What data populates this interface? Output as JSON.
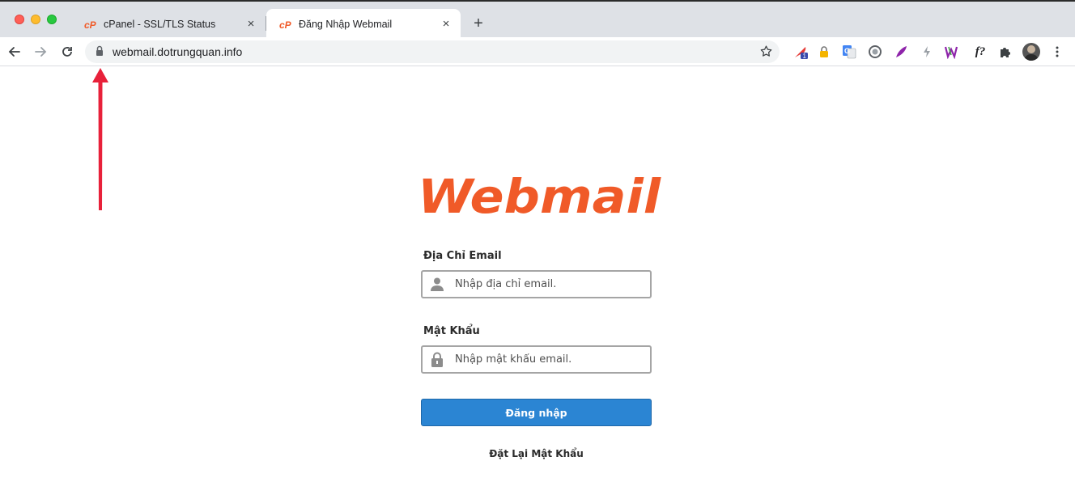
{
  "browser": {
    "tabs": [
      {
        "title": "cPanel - SSL/TLS Status",
        "active": false
      },
      {
        "title": "Đăng Nhập Webmail",
        "active": true
      }
    ],
    "new_tab_label": "+",
    "close_label": "×",
    "url": "webmail.dotrungquan.info",
    "extension_badge": "1",
    "extension_f_label": "f?"
  },
  "page": {
    "logo_text": "Webmail",
    "email": {
      "label": "Địa Chỉ Email",
      "placeholder": "Nhập địa chỉ email.",
      "value": ""
    },
    "password": {
      "label": "Mật Khẩu",
      "placeholder": "Nhập mật khẩu email.",
      "value": ""
    },
    "login_button": "Đăng nhập",
    "reset_link": "Đặt Lại Mật Khẩu"
  },
  "colors": {
    "brand_orange": "#f05a28",
    "button_blue": "#2b85d3",
    "annotation_arrow": "#e8213a"
  }
}
